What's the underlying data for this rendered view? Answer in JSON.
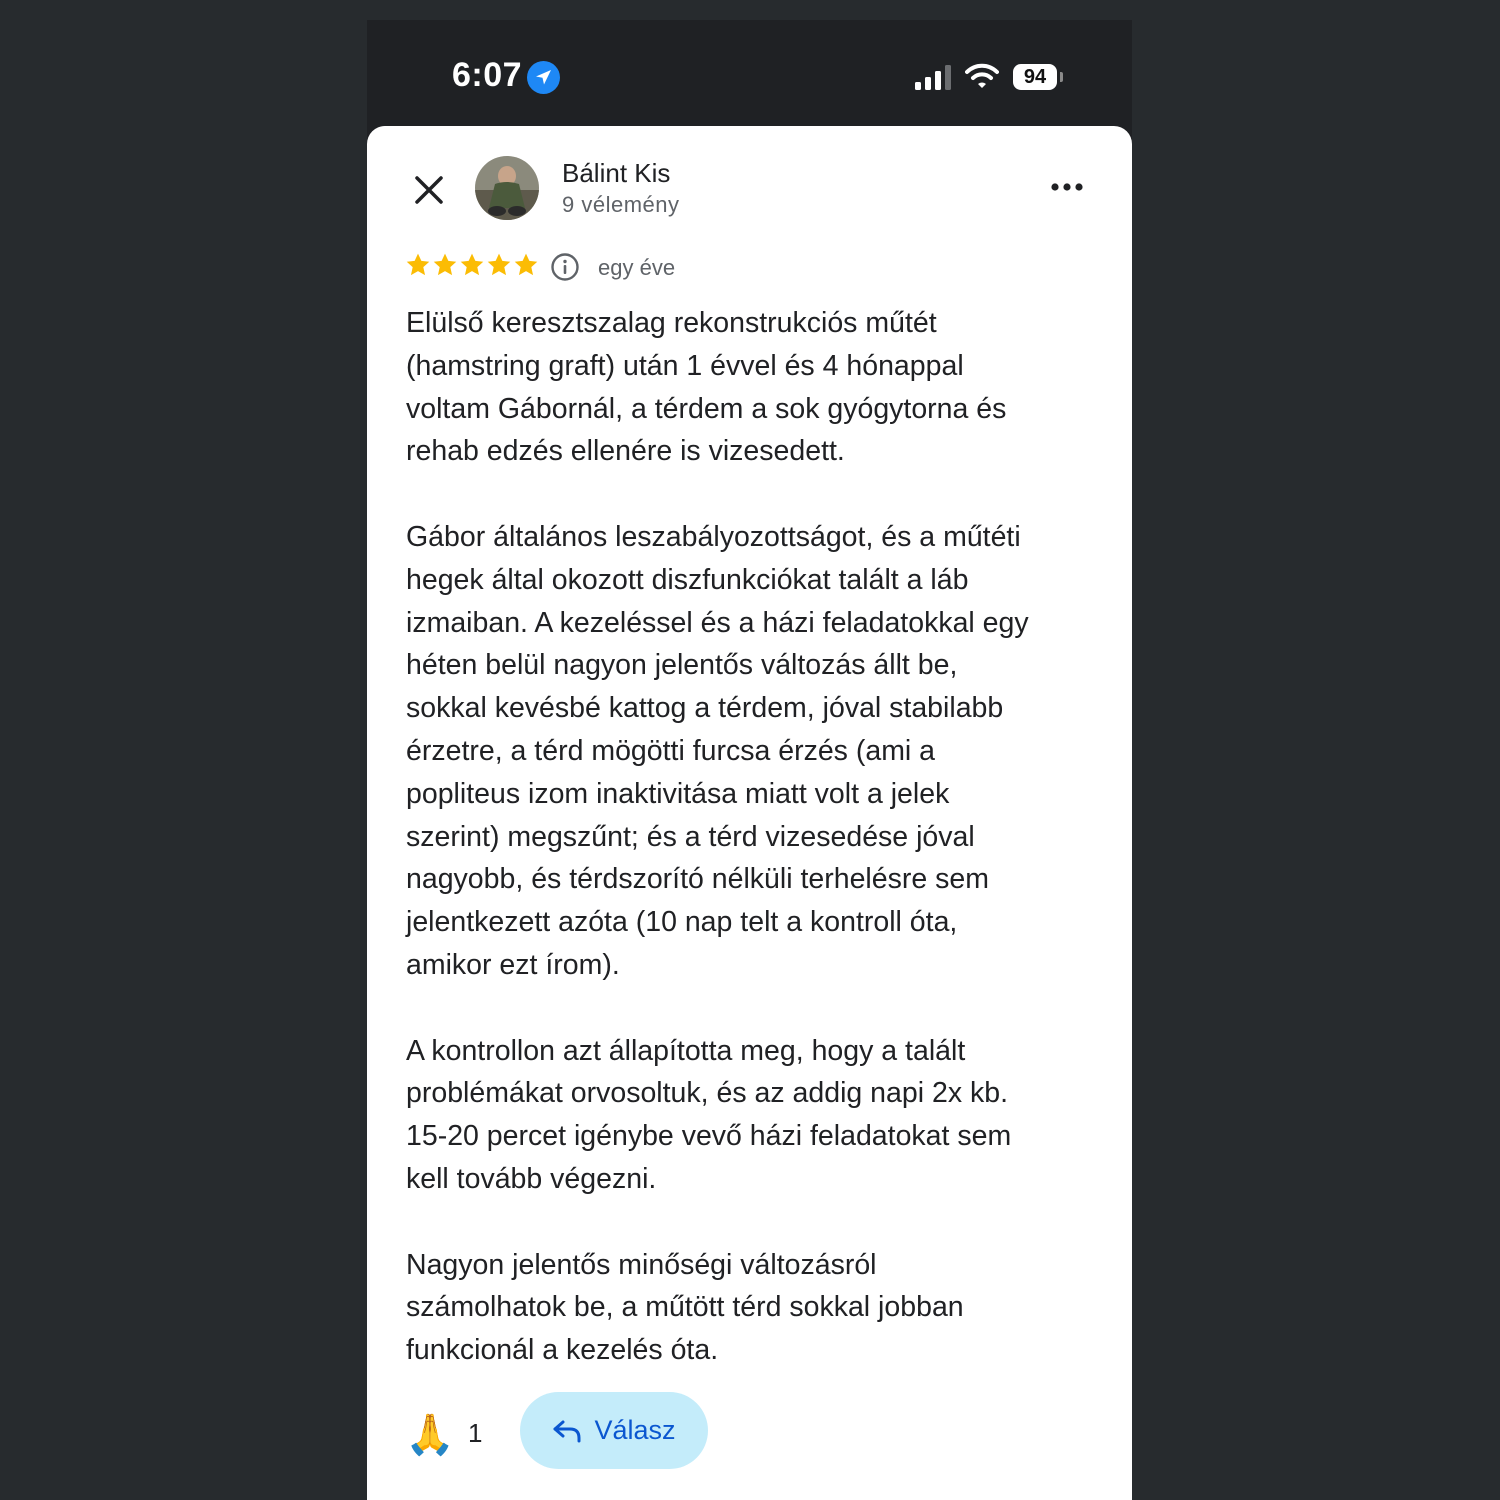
{
  "status_bar": {
    "time": "6:07",
    "battery": "94",
    "icons": [
      "location-arrow-icon",
      "cellular-signal-icon",
      "wifi-icon",
      "battery-icon"
    ]
  },
  "header": {
    "author_name": "Bálint Kis",
    "review_count": "9 vélemény",
    "icons": [
      "close-icon",
      "avatar",
      "more-options-icon"
    ]
  },
  "rating": {
    "stars": 5,
    "max_stars": 5,
    "date": "egy éve",
    "star_color": "#fbbc04",
    "icons": [
      "star-icon",
      "info-icon"
    ]
  },
  "review": {
    "paragraphs": [
      "Elülső keresztszalag rekonstrukciós műtét\n(hamstring graft) után 1 évvel és 4 hónappal\nvoltam Gábornál, a térdem a sok gyógytorna és\nrehab edzés ellenére is vizesedett.",
      "Gábor általános leszabályozottságot, és a műtéti\nhegek által okozott diszfunkciókat talált a láb\nizmaiban. A kezeléssel és a házi feladatokkal egy\nhéten belül nagyon jelentős változás állt be,\nsokkal kevésbé kattog a térdem, jóval stabilabb\nérzetre, a térd mögötti furcsa érzés (ami a\npopliteus izom inaktivitása miatt volt a jelek\nszerint) megszűnt; és a térd vizesedése jóval\nnagyobb, és térdszorító nélküli terhelésre sem\njelentkezett azóta (10 nap telt a kontroll óta,\namikor ezt írom).",
      "A kontrollon azt állapította meg, hogy a talált\nproblémákat orvosoltuk, és az addig napi 2x kb.\n15-20 percet igénybe vevő házi feladatokat sem\nkell tovább végezni.",
      "Nagyon jelentős minőségi változásról\nszámolhatok be, a műtött térd sokkal jobban\nfunkcionál a kezelés óta."
    ]
  },
  "actions": {
    "reaction_emoji": "🙏",
    "reaction_count": "1",
    "reply_label": "Válasz",
    "reply_color": "#c4ecfa",
    "icons": [
      "reply-arrow-icon"
    ]
  }
}
